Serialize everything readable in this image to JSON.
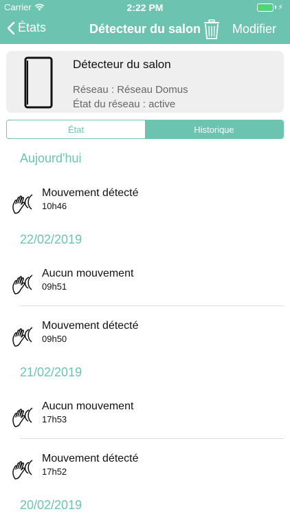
{
  "status_bar": {
    "carrier": "Carrier",
    "time": "2:22 PM"
  },
  "nav": {
    "back_label": "États",
    "title": "Détecteur du salon",
    "edit_label": "Modifier"
  },
  "device": {
    "name": "Détecteur du salon",
    "network_line": "Réseau : Réseau Domus",
    "state_line": "État du réseau : active"
  },
  "tabs": [
    {
      "label": "État",
      "active": false
    },
    {
      "label": "Historique",
      "active": true
    }
  ],
  "history": {
    "groups": [
      {
        "date": "Aujourd'hui",
        "events": [
          {
            "title": "Mouvement détecté",
            "time": "10h46"
          }
        ]
      },
      {
        "date": "22/02/2019",
        "events": [
          {
            "title": "Aucun mouvement",
            "time": "09h51"
          },
          {
            "title": "Mouvement détecté",
            "time": "09h50"
          }
        ]
      },
      {
        "date": "21/02/2019",
        "events": [
          {
            "title": "Aucun mouvement",
            "time": "17h53"
          },
          {
            "title": "Mouvement détecté",
            "time": "17h52"
          }
        ]
      },
      {
        "date": "20/02/2019",
        "events": []
      }
    ]
  },
  "colors": {
    "accent": "#6cc3b0",
    "battery": "#4cd964",
    "card_bg": "#efefef"
  },
  "icons": {
    "back": "chevron-left-icon",
    "trash": "trash-icon",
    "event": "motion-hand-icon",
    "wifi": "wifi-icon",
    "battery": "battery-icon"
  }
}
